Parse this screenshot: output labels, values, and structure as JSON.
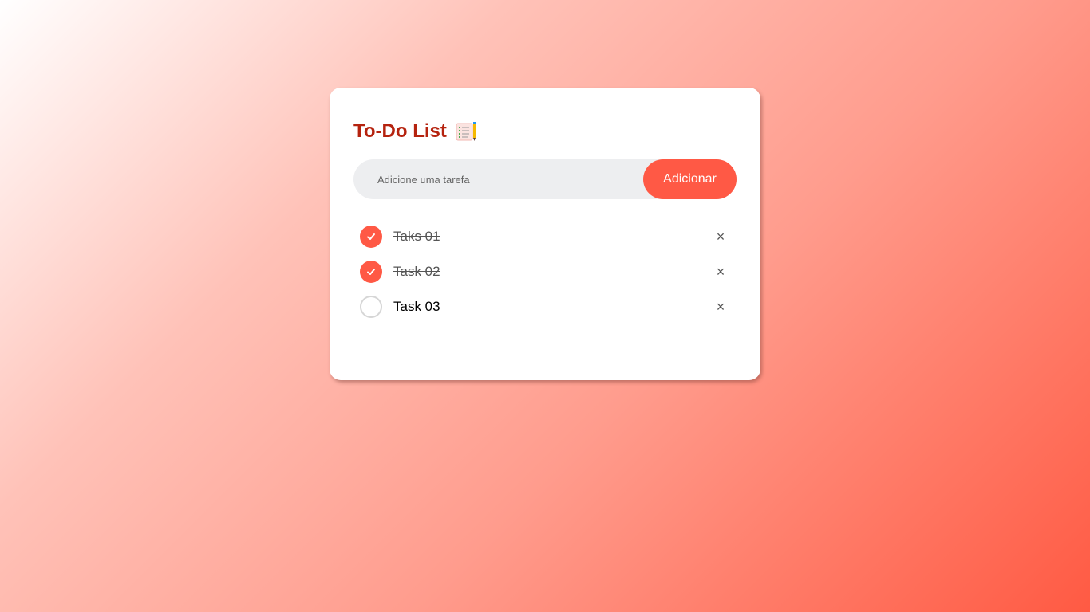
{
  "app": {
    "title": "To-Do List"
  },
  "input": {
    "placeholder": "Adicione uma tarefa",
    "value": ""
  },
  "add_button": {
    "label": "Adicionar"
  },
  "tasks": [
    {
      "text": "Taks 01",
      "done": true
    },
    {
      "text": "Task 02",
      "done": true
    },
    {
      "text": "Task 03",
      "done": false
    }
  ],
  "icons": {
    "title_icon": "notepad-icon",
    "check": "check-icon",
    "remove": "close-icon",
    "remove_glyph": "×"
  },
  "colors": {
    "accent": "#ff5945",
    "title": "#b5230f",
    "input_bg": "#edeef0",
    "gradient_start": "#ffffff",
    "gradient_end": "#ff5a43"
  }
}
